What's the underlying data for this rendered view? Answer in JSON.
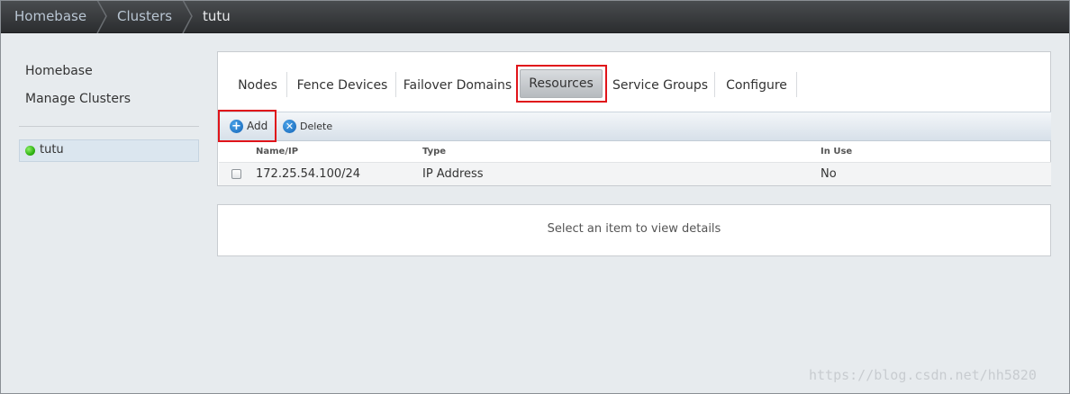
{
  "breadcrumb": {
    "items": [
      "Homebase",
      "Clusters",
      "tutu"
    ]
  },
  "sidebar": {
    "links": [
      "Homebase",
      "Manage Clusters"
    ],
    "clusters": [
      {
        "label": "tutu",
        "status_color": "#2fb313"
      }
    ]
  },
  "tabs": {
    "items": [
      "Nodes",
      "Fence Devices",
      "Failover Domains",
      "Resources",
      "Service Groups",
      "Configure"
    ],
    "active": "Resources"
  },
  "toolbar": {
    "add_label": "Add",
    "delete_label": "Delete"
  },
  "table": {
    "columns": [
      "Name/IP",
      "Type",
      "In Use"
    ],
    "rows": [
      {
        "name": "172.25.54.100/24",
        "type": "IP Address",
        "in_use": "No"
      }
    ]
  },
  "details": {
    "placeholder": "Select an item to view details"
  },
  "watermark": "https://blog.csdn.net/hh5820",
  "colors": {
    "highlight": "#e0141a",
    "accent": "#1565b8"
  }
}
